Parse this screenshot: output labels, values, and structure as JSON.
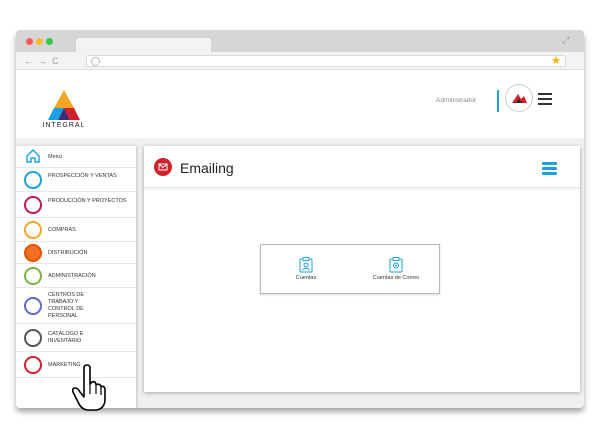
{
  "browser": {
    "window_controls": [
      "close",
      "minimize",
      "maximize"
    ],
    "nav_icons": [
      "back-icon",
      "forward-icon",
      "reload-icon"
    ],
    "url_icon": "globe-icon",
    "bookmark_icon": "star-icon"
  },
  "header": {
    "logo_text": "INTEGRAL",
    "user_label": "Administrador",
    "menu_icon": "hamburger-icon"
  },
  "sidebar": {
    "items": [
      {
        "label": "Menú",
        "icon": "home-icon",
        "color": "#1ba1e2"
      },
      {
        "label": "PROSPECCIÓN Y VENTAS",
        "icon": "prospecting-icon",
        "color": "#1ba1e2"
      },
      {
        "label": "PRODUCCIÓN Y PROYECTOS",
        "icon": "production-icon",
        "color": "#c2185b"
      },
      {
        "label": "COMPRAS",
        "icon": "purchases-icon",
        "color": "#f5a623"
      },
      {
        "label": "DISTRIBUCIÓN",
        "icon": "distribution-icon",
        "color": "#e65100"
      },
      {
        "label": "ADMINISTRACIÓN",
        "icon": "administration-icon",
        "color": "#7cb342"
      },
      {
        "label": "CENTROS DE TRABAJO Y CONTROL DE PERSONAL",
        "icon": "workcenters-icon",
        "color": "#5c6bc0"
      },
      {
        "label": "CATÁLOGO E INVENTARIO",
        "icon": "catalog-icon",
        "color": "#555555"
      },
      {
        "label": "MARKETING",
        "icon": "marketing-icon",
        "color": "#d0212b"
      }
    ]
  },
  "main": {
    "title": "Emailing",
    "title_icon": "mail-icon",
    "menu_icon": "hamburger-icon",
    "options": [
      {
        "label": "Cuentas",
        "icon": "accounts-icon"
      },
      {
        "label": "Cuentas de Correo",
        "icon": "mail-accounts-icon"
      }
    ]
  },
  "colors": {
    "accent": "#1ba1e2",
    "brand_red": "#d0212b",
    "window_bg": "#f0f0f0"
  }
}
